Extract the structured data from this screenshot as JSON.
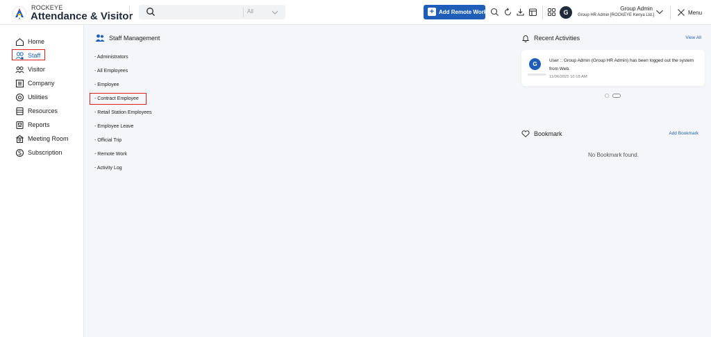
{
  "app": {
    "brand_top": "ROCKEYE",
    "brand_name": "Attendance & Visitor"
  },
  "search": {
    "filter": "All"
  },
  "header": {
    "add_remote_label": "Add Remote Work",
    "avatar_letter": "G",
    "user_name": "Group Admin",
    "user_role": "Group HR Admin [ROCKEYE Kenya Ltd.]",
    "menu_label": "Menu"
  },
  "sidebar": {
    "items": [
      {
        "label": "Home",
        "icon": "home-icon"
      },
      {
        "label": "Staff",
        "icon": "staff-icon"
      },
      {
        "label": "Visitor",
        "icon": "visitor-icon"
      },
      {
        "label": "Company",
        "icon": "company-icon"
      },
      {
        "label": "Utilities",
        "icon": "utilities-icon"
      },
      {
        "label": "Resources",
        "icon": "resources-icon"
      },
      {
        "label": "Reports",
        "icon": "reports-icon"
      },
      {
        "label": "Meeting Room",
        "icon": "meeting-room-icon"
      },
      {
        "label": "Subscription",
        "icon": "subscription-icon"
      }
    ],
    "active": "Staff"
  },
  "staff_panel": {
    "title": "Staff Management",
    "items": [
      "- Administrators",
      "- All Employees",
      "- Employee",
      "- Contract Employee",
      "- Retail Station Employees",
      "- Employee Leave",
      "- Official Trip",
      "- Remote Work",
      "- Activity Log"
    ]
  },
  "recent_activities": {
    "title": "Recent Activities",
    "view_all": "View All",
    "items": [
      {
        "avatar": "G",
        "text": "User :: Group Admin (Group HR Admin) has been logged out the system from Web.",
        "time": "11/06/2025 10:18 AM"
      }
    ]
  },
  "bookmark": {
    "title": "Bookmark",
    "add_label": "Add Bookmark",
    "empty_text": "No Bookmark found."
  },
  "colors": {
    "primary": "#1e5eb8",
    "highlight": "#e02020",
    "background": "#f4f6f9"
  }
}
